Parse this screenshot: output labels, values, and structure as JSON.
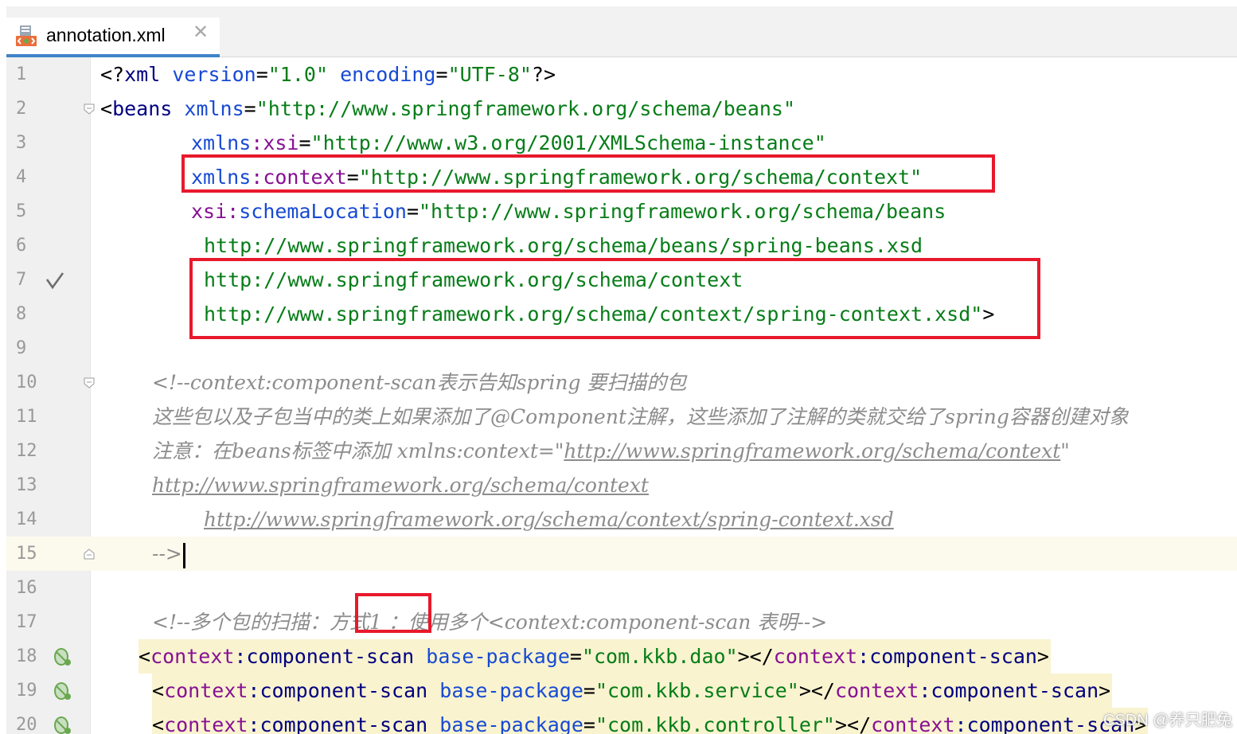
{
  "tab": {
    "filename": "annotation.xml",
    "close_glyph": "✕",
    "icon": "xml-file-icon"
  },
  "colors": {
    "tag": "#000080",
    "attribute": "#174ad4",
    "namespace": "#871094",
    "string": "#067d17",
    "comment": "#8c8c8c",
    "highlight_box": "#e8192c",
    "active_tab_underline": "#4083c9"
  },
  "gutter_icons": {
    "line7": "check-mark-icon",
    "line18": "spring-bean-icon",
    "line19": "spring-bean-icon",
    "line20": "spring-bean-icon"
  },
  "lines": {
    "l1": {
      "num": "1",
      "p1": "<?",
      "p2": "xml",
      "p3": " ",
      "p4": "version",
      "p5": "=",
      "p6": "\"1.0\"",
      "p7": " ",
      "p8": "encoding",
      "p9": "=",
      "p10": "\"UTF-8\"",
      "p11": "?>"
    },
    "l2": {
      "num": "2",
      "p1": "<",
      "p2": "beans",
      "p3": " ",
      "p4": "xmlns",
      "p5": "=",
      "p6": "\"http://www.springframework.org/schema/beans\""
    },
    "l3": {
      "num": "3",
      "p1": "xmlns",
      "p2": ":",
      "p3": "xsi",
      "p4": "=",
      "p5": "\"http://www.w3.org/2001/XMLSchema-instance\""
    },
    "l4": {
      "num": "4",
      "p1": "xmlns",
      "p2": ":",
      "p3": "context",
      "p4": "=",
      "p5": "\"http://www.springframework.org/schema/context\""
    },
    "l5": {
      "num": "5",
      "p1": "xsi",
      "p2": ":",
      "p3": "schemaLocation",
      "p4": "=",
      "p5": "\"http://www.springframework.org/schema/beans"
    },
    "l6": {
      "num": "6",
      "p1": "http://www.springframework.org/schema/beans/spring-beans.xsd"
    },
    "l7": {
      "num": "7",
      "p1": "http://www.springframework.org/schema/context"
    },
    "l8": {
      "num": "8",
      "p1": "http://www.springframework.org/schema/context/spring-context.xsd",
      "p2": "\"",
      "p3": ">"
    },
    "l9": {
      "num": "9"
    },
    "l10": {
      "num": "10",
      "text": "<!--context:component-scan表示告知spring 要扫描的包"
    },
    "l11": {
      "num": "11",
      "text": "这些包以及子包当中的类上如果添加了@Component注解，这些添加了注解的类就交给了spring容器创建对象"
    },
    "l12": {
      "num": "12",
      "p1": "注意：在beans标签中添加 xmlns:context=\"",
      "p2": "http://www.springframework.org/schema/context",
      "p3": "\""
    },
    "l13": {
      "num": "13",
      "p1": "http://www.springframework.org/schema/context"
    },
    "l14": {
      "num": "14",
      "p1": "http://www.springframework.org/schema/context/spring-context.xsd"
    },
    "l15": {
      "num": "15",
      "text": "-->"
    },
    "l16": {
      "num": "16"
    },
    "l17": {
      "num": "17",
      "p1": "<!--多个包的扫描：",
      "p2": "方式1",
      "p3": " ：使用多个<context:component-scan 表明-->"
    },
    "l18": {
      "num": "18",
      "p1": "<",
      "p2": "context",
      "p3": ":",
      "p4": "component-scan",
      "p5": " ",
      "p6": "base-package",
      "p7": "=",
      "p8": "\"com.kkb.dao\"",
      "p9": "></",
      "p10": "context",
      "p11": ":",
      "p12": "component-scan",
      "p13": ">"
    },
    "l19": {
      "num": "19",
      "p1": "<",
      "p2": "context",
      "p3": ":",
      "p4": "component-scan",
      "p5": " ",
      "p6": "base-package",
      "p7": "=",
      "p8": "\"com.kkb.service\"",
      "p9": "></",
      "p10": "context",
      "p11": ":",
      "p12": "component-scan",
      "p13": ">"
    },
    "l20": {
      "num": "20",
      "p1": "<",
      "p2": "context",
      "p3": ":",
      "p4": "component-scan",
      "p5": " ",
      "p6": "base-package",
      "p7": "=",
      "p8": "\"com.kkb.controller\"",
      "p9": "></",
      "p10": "context",
      "p11": ":",
      "p12": "component-scan",
      "p13": ">"
    }
  },
  "watermark": "CSDN @养只肥兔"
}
